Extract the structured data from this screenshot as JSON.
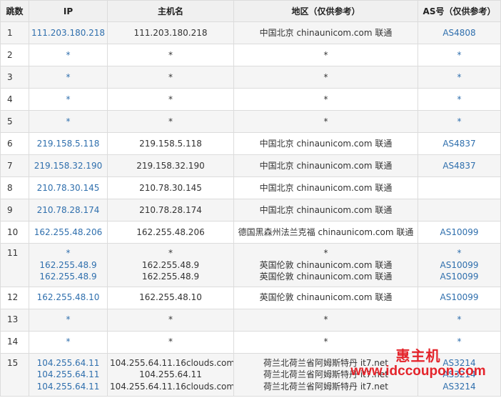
{
  "table": {
    "headers": [
      "跳数",
      "IP",
      "主机名",
      "地区（仅供参考）",
      "AS号（仅供参考）"
    ],
    "rows": [
      {
        "hop": "1",
        "ip": [
          "111.203.180.218"
        ],
        "host": [
          "111.203.180.218"
        ],
        "region": [
          "中国北京 chinaunicom.com 联通"
        ],
        "as": [
          "AS4808"
        ]
      },
      {
        "hop": "2",
        "ip": [
          "*"
        ],
        "host": [
          "*"
        ],
        "region": [
          "*"
        ],
        "as": [
          "*"
        ]
      },
      {
        "hop": "3",
        "ip": [
          "*"
        ],
        "host": [
          "*"
        ],
        "region": [
          "*"
        ],
        "as": [
          "*"
        ]
      },
      {
        "hop": "4",
        "ip": [
          "*"
        ],
        "host": [
          "*"
        ],
        "region": [
          "*"
        ],
        "as": [
          "*"
        ]
      },
      {
        "hop": "5",
        "ip": [
          "*"
        ],
        "host": [
          "*"
        ],
        "region": [
          "*"
        ],
        "as": [
          "*"
        ]
      },
      {
        "hop": "6",
        "ip": [
          "219.158.5.118"
        ],
        "host": [
          "219.158.5.118"
        ],
        "region": [
          "中国北京 chinaunicom.com 联通"
        ],
        "as": [
          "AS4837"
        ]
      },
      {
        "hop": "7",
        "ip": [
          "219.158.32.190"
        ],
        "host": [
          "219.158.32.190"
        ],
        "region": [
          "中国北京 chinaunicom.com 联通"
        ],
        "as": [
          "AS4837"
        ]
      },
      {
        "hop": "8",
        "ip": [
          "210.78.30.145"
        ],
        "host": [
          "210.78.30.145"
        ],
        "region": [
          "中国北京 chinaunicom.com 联通"
        ],
        "as": [
          ""
        ]
      },
      {
        "hop": "9",
        "ip": [
          "210.78.28.174"
        ],
        "host": [
          "210.78.28.174"
        ],
        "region": [
          "中国北京 chinaunicom.com 联通"
        ],
        "as": [
          ""
        ]
      },
      {
        "hop": "10",
        "ip": [
          "162.255.48.206"
        ],
        "host": [
          "162.255.48.206"
        ],
        "region": [
          "德国黑森州法兰克福 chinaunicom.com 联通"
        ],
        "as": [
          "AS10099"
        ]
      },
      {
        "hop": "11",
        "ip": [
          "*",
          "162.255.48.9",
          "162.255.48.9"
        ],
        "host": [
          "*",
          "162.255.48.9",
          "162.255.48.9"
        ],
        "region": [
          "*",
          "英国伦敦 chinaunicom.com 联通",
          "英国伦敦 chinaunicom.com 联通"
        ],
        "as": [
          "*",
          "AS10099",
          "AS10099"
        ]
      },
      {
        "hop": "12",
        "ip": [
          "162.255.48.10"
        ],
        "host": [
          "162.255.48.10"
        ],
        "region": [
          "英国伦敦 chinaunicom.com 联通"
        ],
        "as": [
          "AS10099"
        ]
      },
      {
        "hop": "13",
        "ip": [
          "*"
        ],
        "host": [
          "*"
        ],
        "region": [
          "*"
        ],
        "as": [
          "*"
        ]
      },
      {
        "hop": "14",
        "ip": [
          "*"
        ],
        "host": [
          "*"
        ],
        "region": [
          "*"
        ],
        "as": [
          "*"
        ]
      },
      {
        "hop": "15",
        "ip": [
          "104.255.64.11",
          "104.255.64.11",
          "104.255.64.11"
        ],
        "host": [
          "104.255.64.11.16clouds.com",
          "104.255.64.11",
          "104.255.64.11.16clouds.com"
        ],
        "region": [
          "荷兰北荷兰省阿姆斯特丹 it7.net",
          "荷兰北荷兰省阿姆斯特丹 it7.net",
          "荷兰北荷兰省阿姆斯特丹 it7.net"
        ],
        "as": [
          "AS3214",
          "AS3214",
          "AS3214"
        ]
      }
    ]
  },
  "watermark": {
    "title": "惠主机",
    "url": "www.idccoupon.com"
  },
  "colors": {
    "link": "#2f6fad",
    "watermark": "#e4242b",
    "header_bg": "#f0f0f0",
    "stripe_bg": "#f5f5f5",
    "border": "#dcdcdc"
  }
}
